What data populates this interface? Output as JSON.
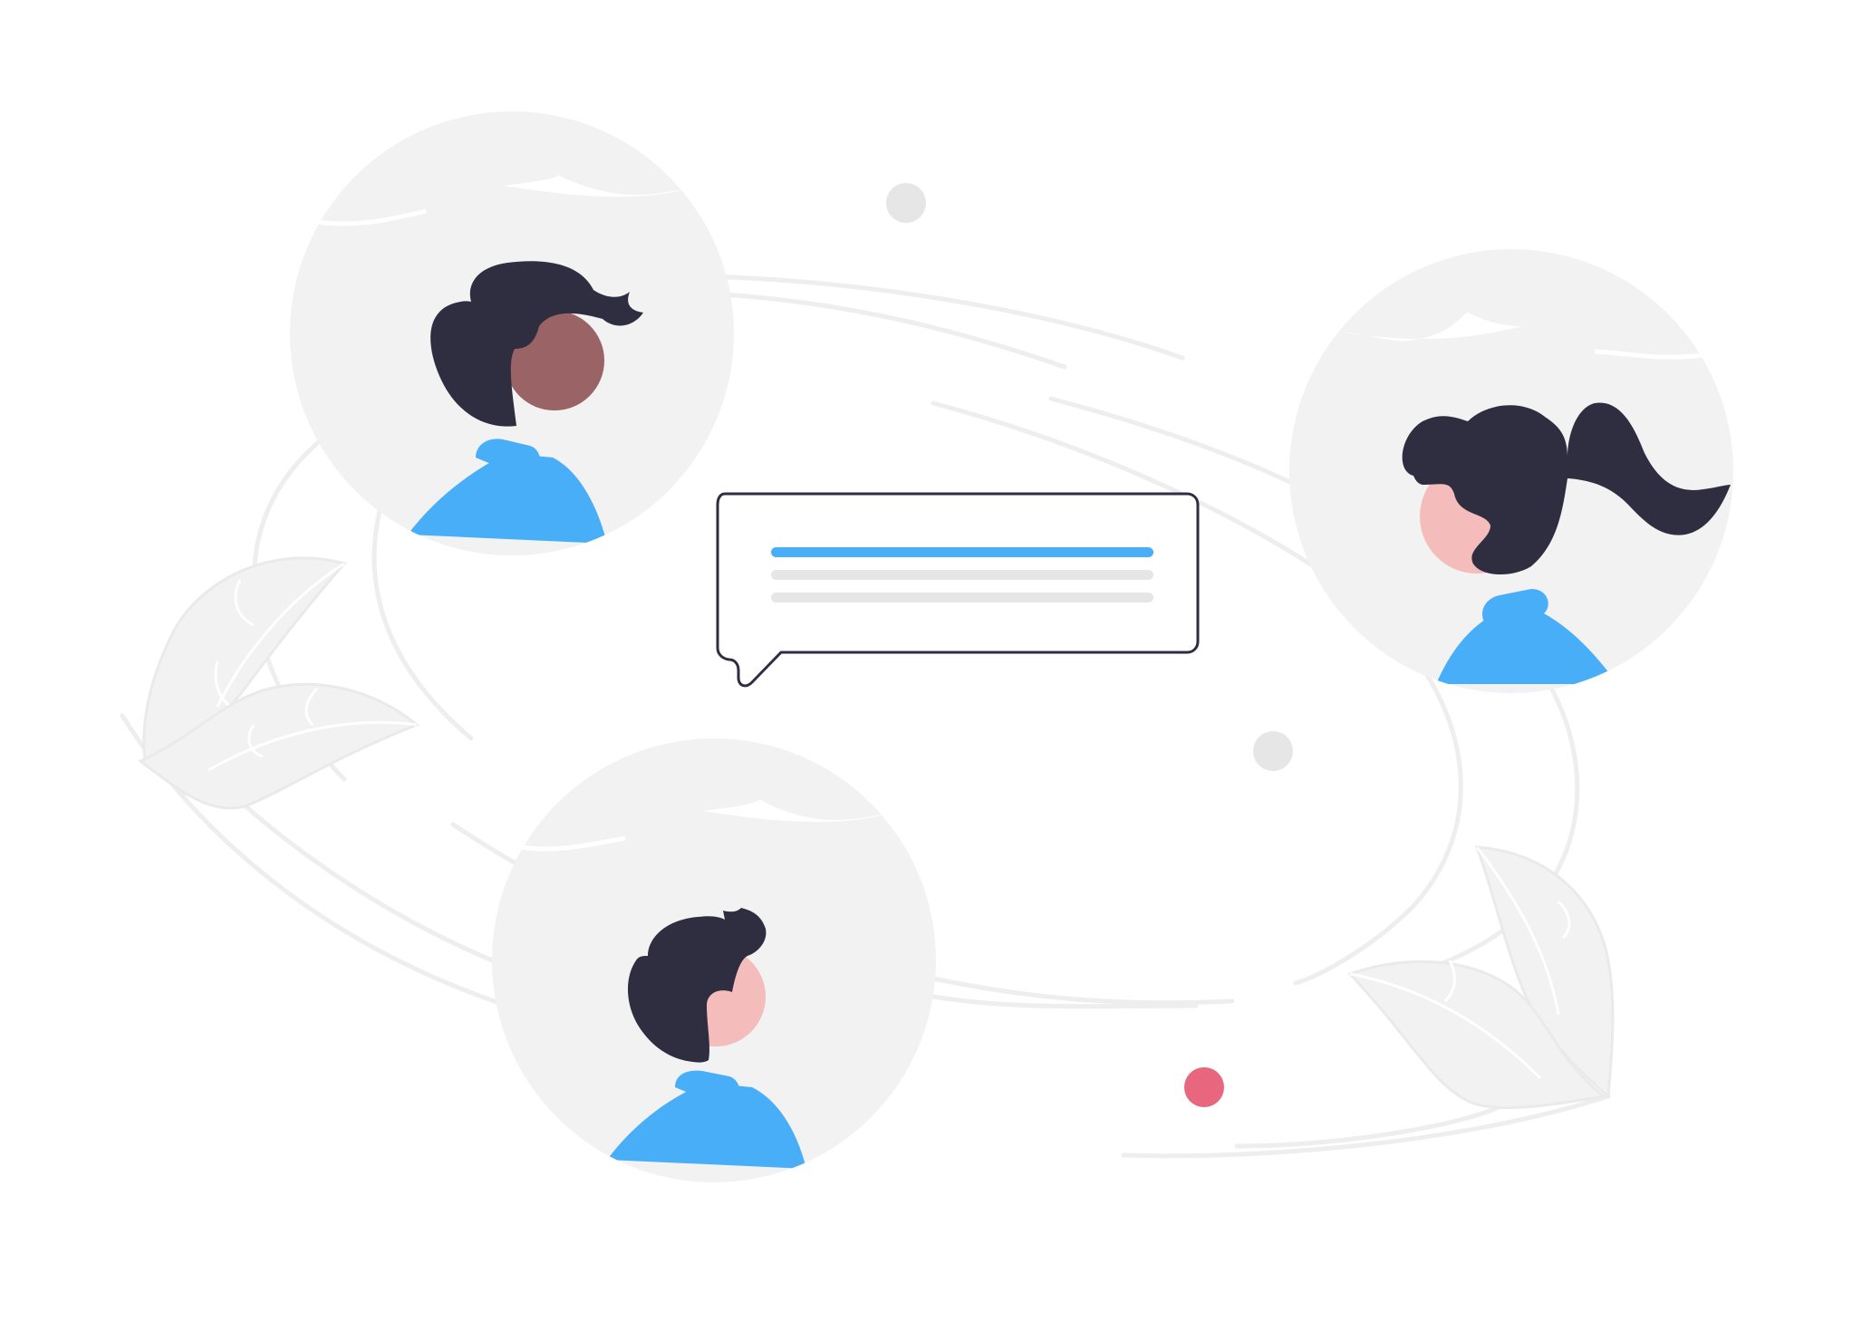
{
  "illustration": {
    "subject": "",
    "avatars": [
      {
        "id": "avatar-top-left",
        "skin": "#9a6366",
        "hair": "#2f2e41",
        "sweater": "#48aef7"
      },
      {
        "id": "avatar-right",
        "skin": "#f4bcbb",
        "hair": "#2f2e41",
        "sweater": "#48aef7"
      },
      {
        "id": "avatar-bottom",
        "skin": "#f4bcbb",
        "hair": "#2f2e41",
        "sweater": "#48aef7"
      }
    ],
    "message_bubble": {
      "lines": [
        "accent",
        "placeholder",
        "placeholder"
      ]
    }
  },
  "colors": {
    "background": "#ffffff",
    "circle_fill": "#f2f2f2",
    "line_stroke": "#eeeeee",
    "accent": "#48aef7",
    "placeholder": "#e6e6e6",
    "outline": "#2f2e41",
    "dot_gray": "#e6e6e6",
    "dot_pink": "#e8677e"
  },
  "icons": [
    "leaf-icon",
    "chat-bubble-icon",
    "person-icon"
  ]
}
